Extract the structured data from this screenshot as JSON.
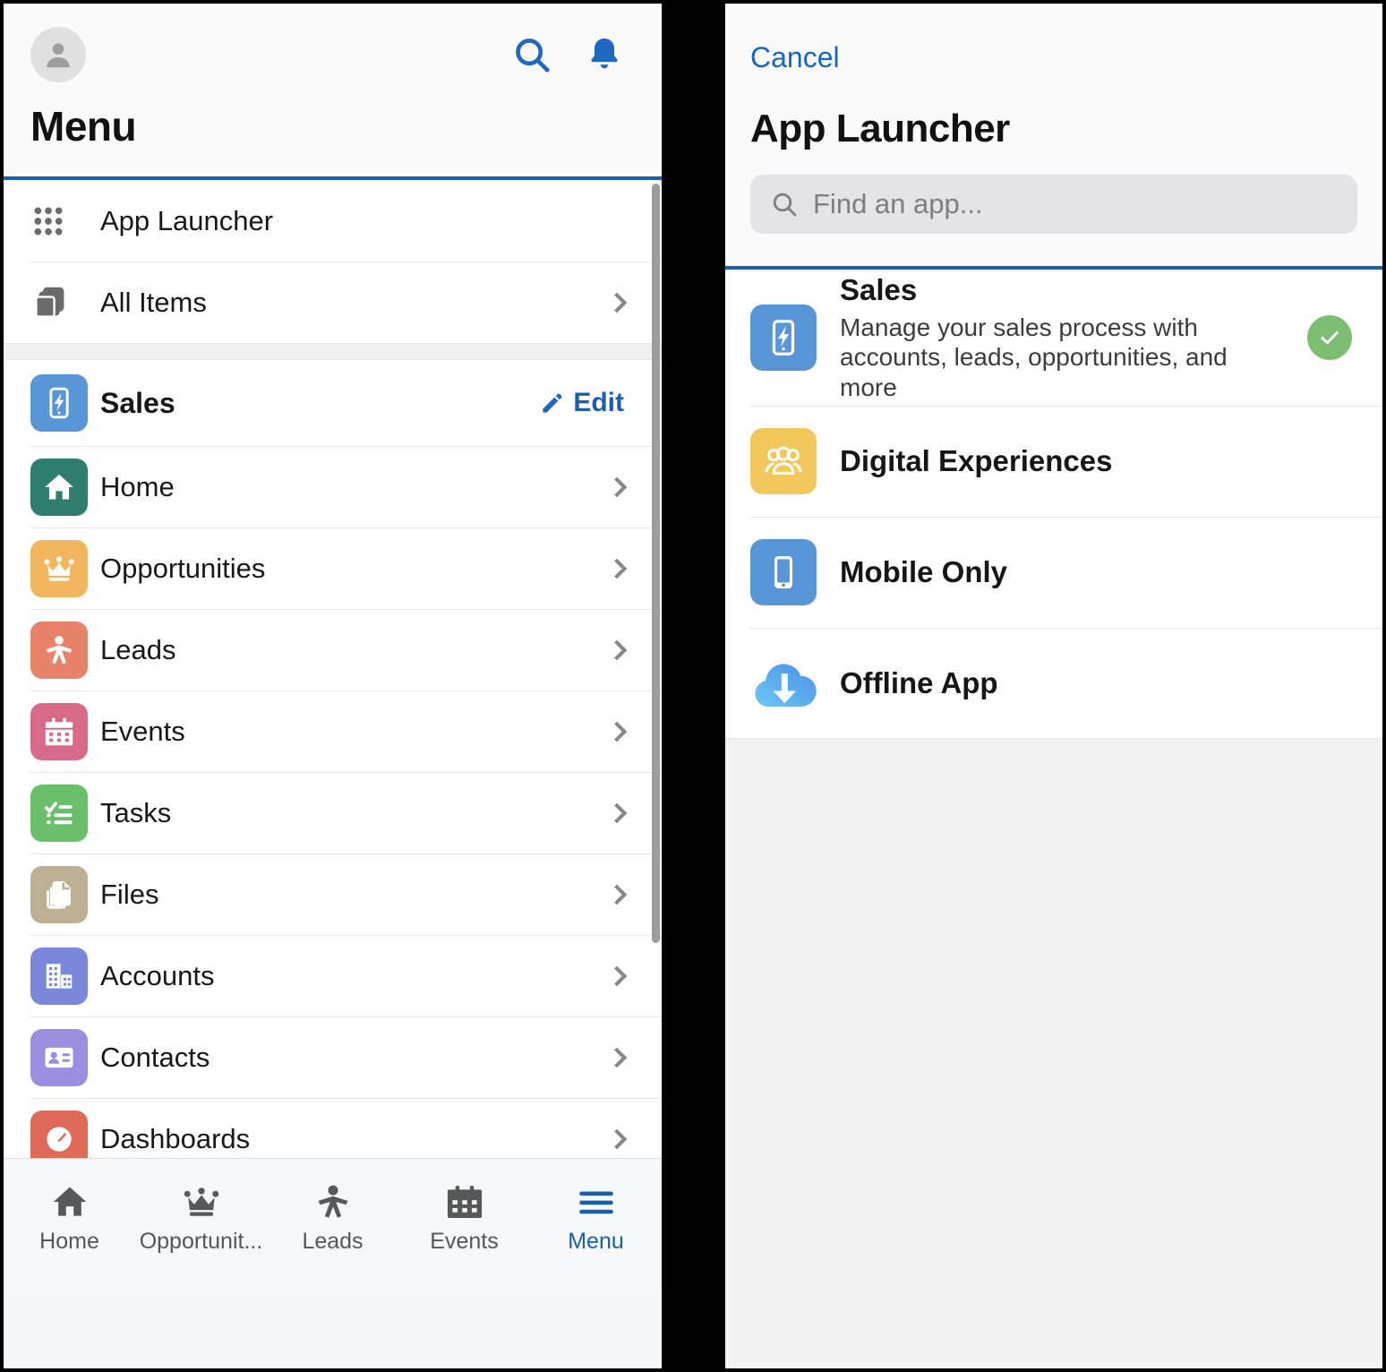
{
  "left_panel": {
    "header": {
      "avatar_icon": "user-avatar-icon",
      "search_icon": "search-icon",
      "notification_icon": "bell-icon",
      "title": "Menu"
    },
    "top_items": [
      {
        "label": "App Launcher",
        "icon": "app-grid-icon",
        "chevron": false
      },
      {
        "label": "All Items",
        "icon": "stacked-cards-icon",
        "chevron": true
      }
    ],
    "app_section": {
      "app_name": "Sales",
      "app_icon": "sales-lightning-phone-icon",
      "edit_label": "Edit",
      "edit_icon": "pencil-icon"
    },
    "nav_items": [
      {
        "label": "Home",
        "icon": "house-icon",
        "color": "#2e7d6f",
        "chevron": true
      },
      {
        "label": "Opportunities",
        "icon": "crown-icon",
        "color": "#f2b65e",
        "chevron": true
      },
      {
        "label": "Leads",
        "icon": "person-star-icon",
        "color": "#e8826b",
        "chevron": true
      },
      {
        "label": "Events",
        "icon": "calendar-icon",
        "color": "#d76a86",
        "chevron": true
      },
      {
        "label": "Tasks",
        "icon": "checklist-icon",
        "color": "#6bbf6b",
        "chevron": true
      },
      {
        "label": "Files",
        "icon": "documents-icon",
        "color": "#bdaf93",
        "chevron": true
      },
      {
        "label": "Accounts",
        "icon": "building-icon",
        "color": "#7b87d9",
        "chevron": true
      },
      {
        "label": "Contacts",
        "icon": "contact-card-icon",
        "color": "#9b8ee0",
        "chevron": true
      },
      {
        "label": "Dashboards",
        "icon": "gauge-icon",
        "color": "#e06a5a",
        "chevron": true
      }
    ],
    "tabbar": [
      {
        "label": "Home",
        "icon": "house-icon",
        "active": false
      },
      {
        "label": "Opportunit...",
        "icon": "crown-icon",
        "active": false
      },
      {
        "label": "Leads",
        "icon": "person-star-icon",
        "active": false
      },
      {
        "label": "Events",
        "icon": "calendar-icon",
        "active": false
      },
      {
        "label": "Menu",
        "icon": "hamburger-icon",
        "active": true
      }
    ]
  },
  "right_panel": {
    "cancel_label": "Cancel",
    "title": "App Launcher",
    "search": {
      "placeholder": "Find an app...",
      "value": "",
      "icon": "search-icon"
    },
    "apps": [
      {
        "name": "Sales",
        "description": "Manage your sales process with accounts, leads, opportunities, and more",
        "icon": "sales-lightning-phone-icon",
        "color": "#5896d8",
        "selected": true
      },
      {
        "name": "Digital Experiences",
        "description": "",
        "icon": "people-group-icon",
        "color": "#f2c85c",
        "selected": false
      },
      {
        "name": "Mobile Only",
        "description": "",
        "icon": "phone-icon",
        "color": "#5896d8",
        "selected": false
      },
      {
        "name": "Offline App",
        "description": "",
        "icon": "cloud-download-icon",
        "color": "#55a8f0",
        "selected": false
      }
    ],
    "selected_badge_icon": "check-circle-icon"
  },
  "colors": {
    "accent_blue": "#1b5faa",
    "link_blue": "#1765c7",
    "selected_green": "#7cbf72",
    "sales_blue": "#5896d8"
  }
}
